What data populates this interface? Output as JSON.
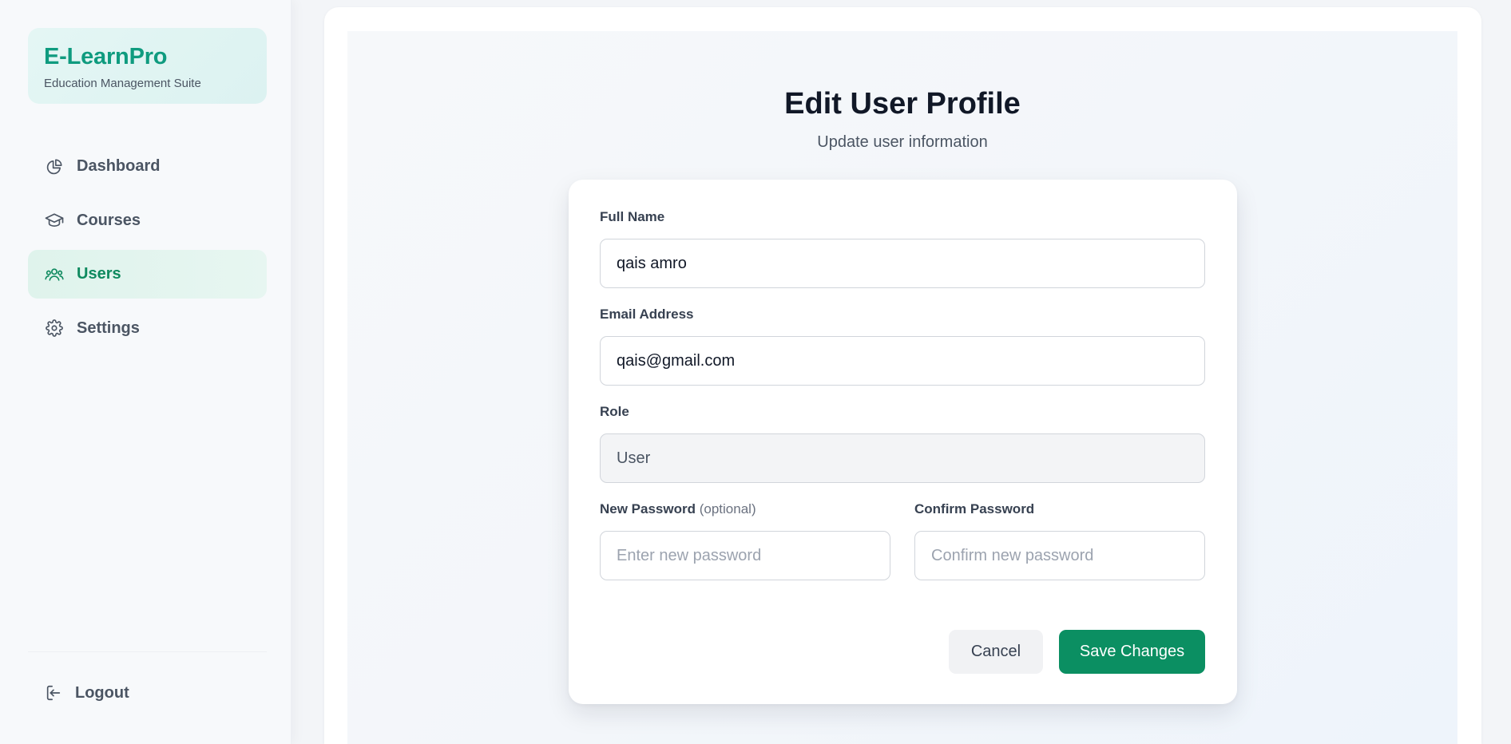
{
  "brand": {
    "name": "E-LearnPro",
    "subtitle": "Education Management Suite"
  },
  "sidebar": {
    "items": [
      {
        "label": "Dashboard",
        "icon": "pie-chart-icon",
        "active": false
      },
      {
        "label": "Courses",
        "icon": "graduation-cap-icon",
        "active": false
      },
      {
        "label": "Users",
        "icon": "users-icon",
        "active": true
      },
      {
        "label": "Settings",
        "icon": "gear-icon",
        "active": false
      }
    ],
    "logout_label": "Logout",
    "logout_icon": "logout-icon"
  },
  "page": {
    "title": "Edit User Profile",
    "subtitle": "Update user information"
  },
  "form": {
    "full_name_label": "Full Name",
    "full_name_value": "qais amro",
    "email_label": "Email Address",
    "email_value": "qais@gmail.com",
    "role_label": "Role",
    "role_value": "User",
    "new_password_label": "New Password",
    "new_password_optional": "(optional)",
    "new_password_placeholder": "Enter new password",
    "confirm_password_label": "Confirm Password",
    "confirm_password_placeholder": "Confirm new password",
    "cancel_label": "Cancel",
    "save_label": "Save Changes"
  },
  "colors": {
    "brand": "#0f9b7f",
    "active_nav_text": "#0f8a5f",
    "save_button": "#0b8f62"
  }
}
